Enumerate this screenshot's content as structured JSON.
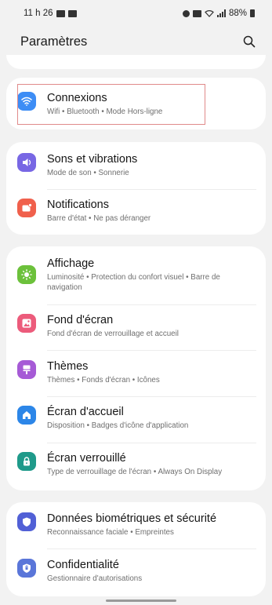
{
  "status": {
    "time": "11 h 26",
    "battery": "88%"
  },
  "header": {
    "title": "Paramètres",
    "search_icon": "search-icon"
  },
  "groups": [
    {
      "items": [
        {
          "label": "Connexions",
          "sub": "Wifi  •  Bluetooth  •  Mode Hors-ligne",
          "icon": "wifi-icon",
          "color": "#3d8df5"
        }
      ]
    },
    {
      "items": [
        {
          "label": "Sons et vibrations",
          "sub": "Mode de son  •  Sonnerie",
          "icon": "volume-icon",
          "color": "#7867e4"
        },
        {
          "label": "Notifications",
          "sub": "Barre d'état  •  Ne pas déranger",
          "icon": "notification-icon",
          "color": "#f0604c"
        }
      ]
    },
    {
      "items": [
        {
          "label": "Affichage",
          "sub": "Luminosité  •  Protection du confort visuel  •  Barre de navigation",
          "icon": "brightness-icon",
          "color": "#6cc13b"
        },
        {
          "label": "Fond d'écran",
          "sub": "Fond d'écran de verrouillage et accueil",
          "icon": "wallpaper-icon",
          "color": "#ec5b7b"
        },
        {
          "label": "Thèmes",
          "sub": "Thèmes  •  Fonds d'écran  •  Icônes",
          "icon": "brush-icon",
          "color": "#a65ad6"
        },
        {
          "label": "Écran d'accueil",
          "sub": "Disposition  •  Badges d'icône d'application",
          "icon": "home-icon",
          "color": "#2c86e8"
        },
        {
          "label": "Écran verrouillé",
          "sub": "Type de verrouillage de l'écran  •  Always On Display",
          "icon": "lock-icon",
          "color": "#1f9a8a"
        }
      ]
    },
    {
      "items": [
        {
          "label": "Données biométriques et sécurité",
          "sub": "Reconnaissance faciale  •  Empreintes",
          "icon": "shield-icon",
          "color": "#5160d6"
        },
        {
          "label": "Confidentialité",
          "sub": "Gestionnaire d'autorisations",
          "icon": "privacy-icon",
          "color": "#5a76d9"
        }
      ]
    }
  ]
}
